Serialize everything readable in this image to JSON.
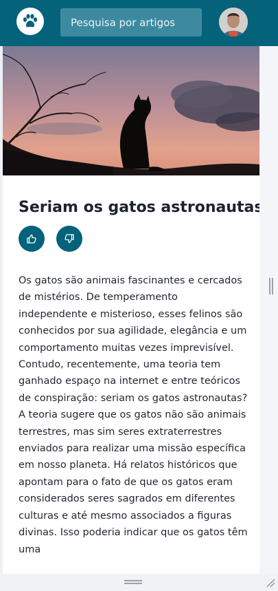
{
  "search": {
    "placeholder": "Pesquisa por artigos"
  },
  "icons": {
    "logo": "paw-icon",
    "like": "thumbs-up-icon",
    "dislike": "thumbs-down-icon"
  },
  "colors": {
    "brand": "#05627b",
    "search_bg": "#3d8aa0"
  },
  "article": {
    "title": "Seriam os gatos astronautas?",
    "paragraphs": [
      "Os gatos são animais fascinantes e cercados de mistérios. De temperamento independente e misterioso, esses felinos são conhecidos por sua agilidade, elegância e um comportamento muitas vezes imprevisível. Contudo, recentemente, uma teoria tem ganhado espaço na internet e entre teóricos de conspiração: seriam os gatos astronautas?",
      "A teoria sugere que os gatos não são animais terrestres, mas sim seres extraterrestres enviados para realizar uma missão específica em nosso planeta. Há relatos históricos que apontam para o fato de que os gatos eram considerados seres sagrados em diferentes culturas e até mesmo associados a figuras divinas. Isso poderia indicar que os gatos têm uma"
    ]
  }
}
